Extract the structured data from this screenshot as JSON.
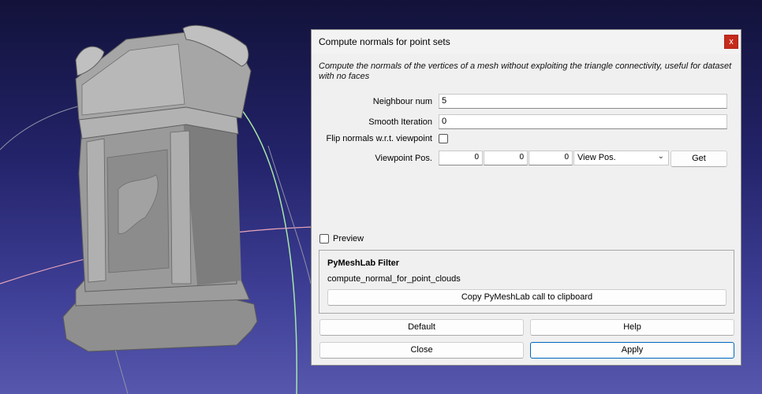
{
  "dialog": {
    "title": "Compute normals for point sets",
    "close_glyph": "x",
    "description": "Compute the normals of the vertices of a mesh without exploiting the triangle connectivity, useful for dataset with no faces",
    "params": {
      "neighbour_num": {
        "label": "Neighbour num",
        "value": "5"
      },
      "smooth_iteration": {
        "label": "Smooth Iteration",
        "value": "0"
      },
      "flip_normals": {
        "label": "Flip normals w.r.t. viewpoint",
        "checked": false
      },
      "viewpoint_pos": {
        "label": "Viewpoint Pos.",
        "x": "0",
        "y": "0",
        "z": "0",
        "select_value": "View Pos.",
        "get_label": "Get"
      }
    },
    "preview": {
      "label": "Preview",
      "checked": false
    },
    "pymeshlab": {
      "title": "PyMeshLab Filter",
      "function_name": "compute_normal_for_point_clouds",
      "copy_label": "Copy PyMeshLab call to clipboard"
    },
    "buttons": {
      "default": "Default",
      "help": "Help",
      "close": "Close",
      "apply": "Apply"
    }
  },
  "colors": {
    "viewport_bg_top": "#12123a",
    "viewport_bg_bottom": "#5657ad",
    "close_x_bg": "#c42b1c",
    "apply_border": "#0067c0"
  },
  "icons": {
    "dropdown": "chevron-down-icon"
  }
}
